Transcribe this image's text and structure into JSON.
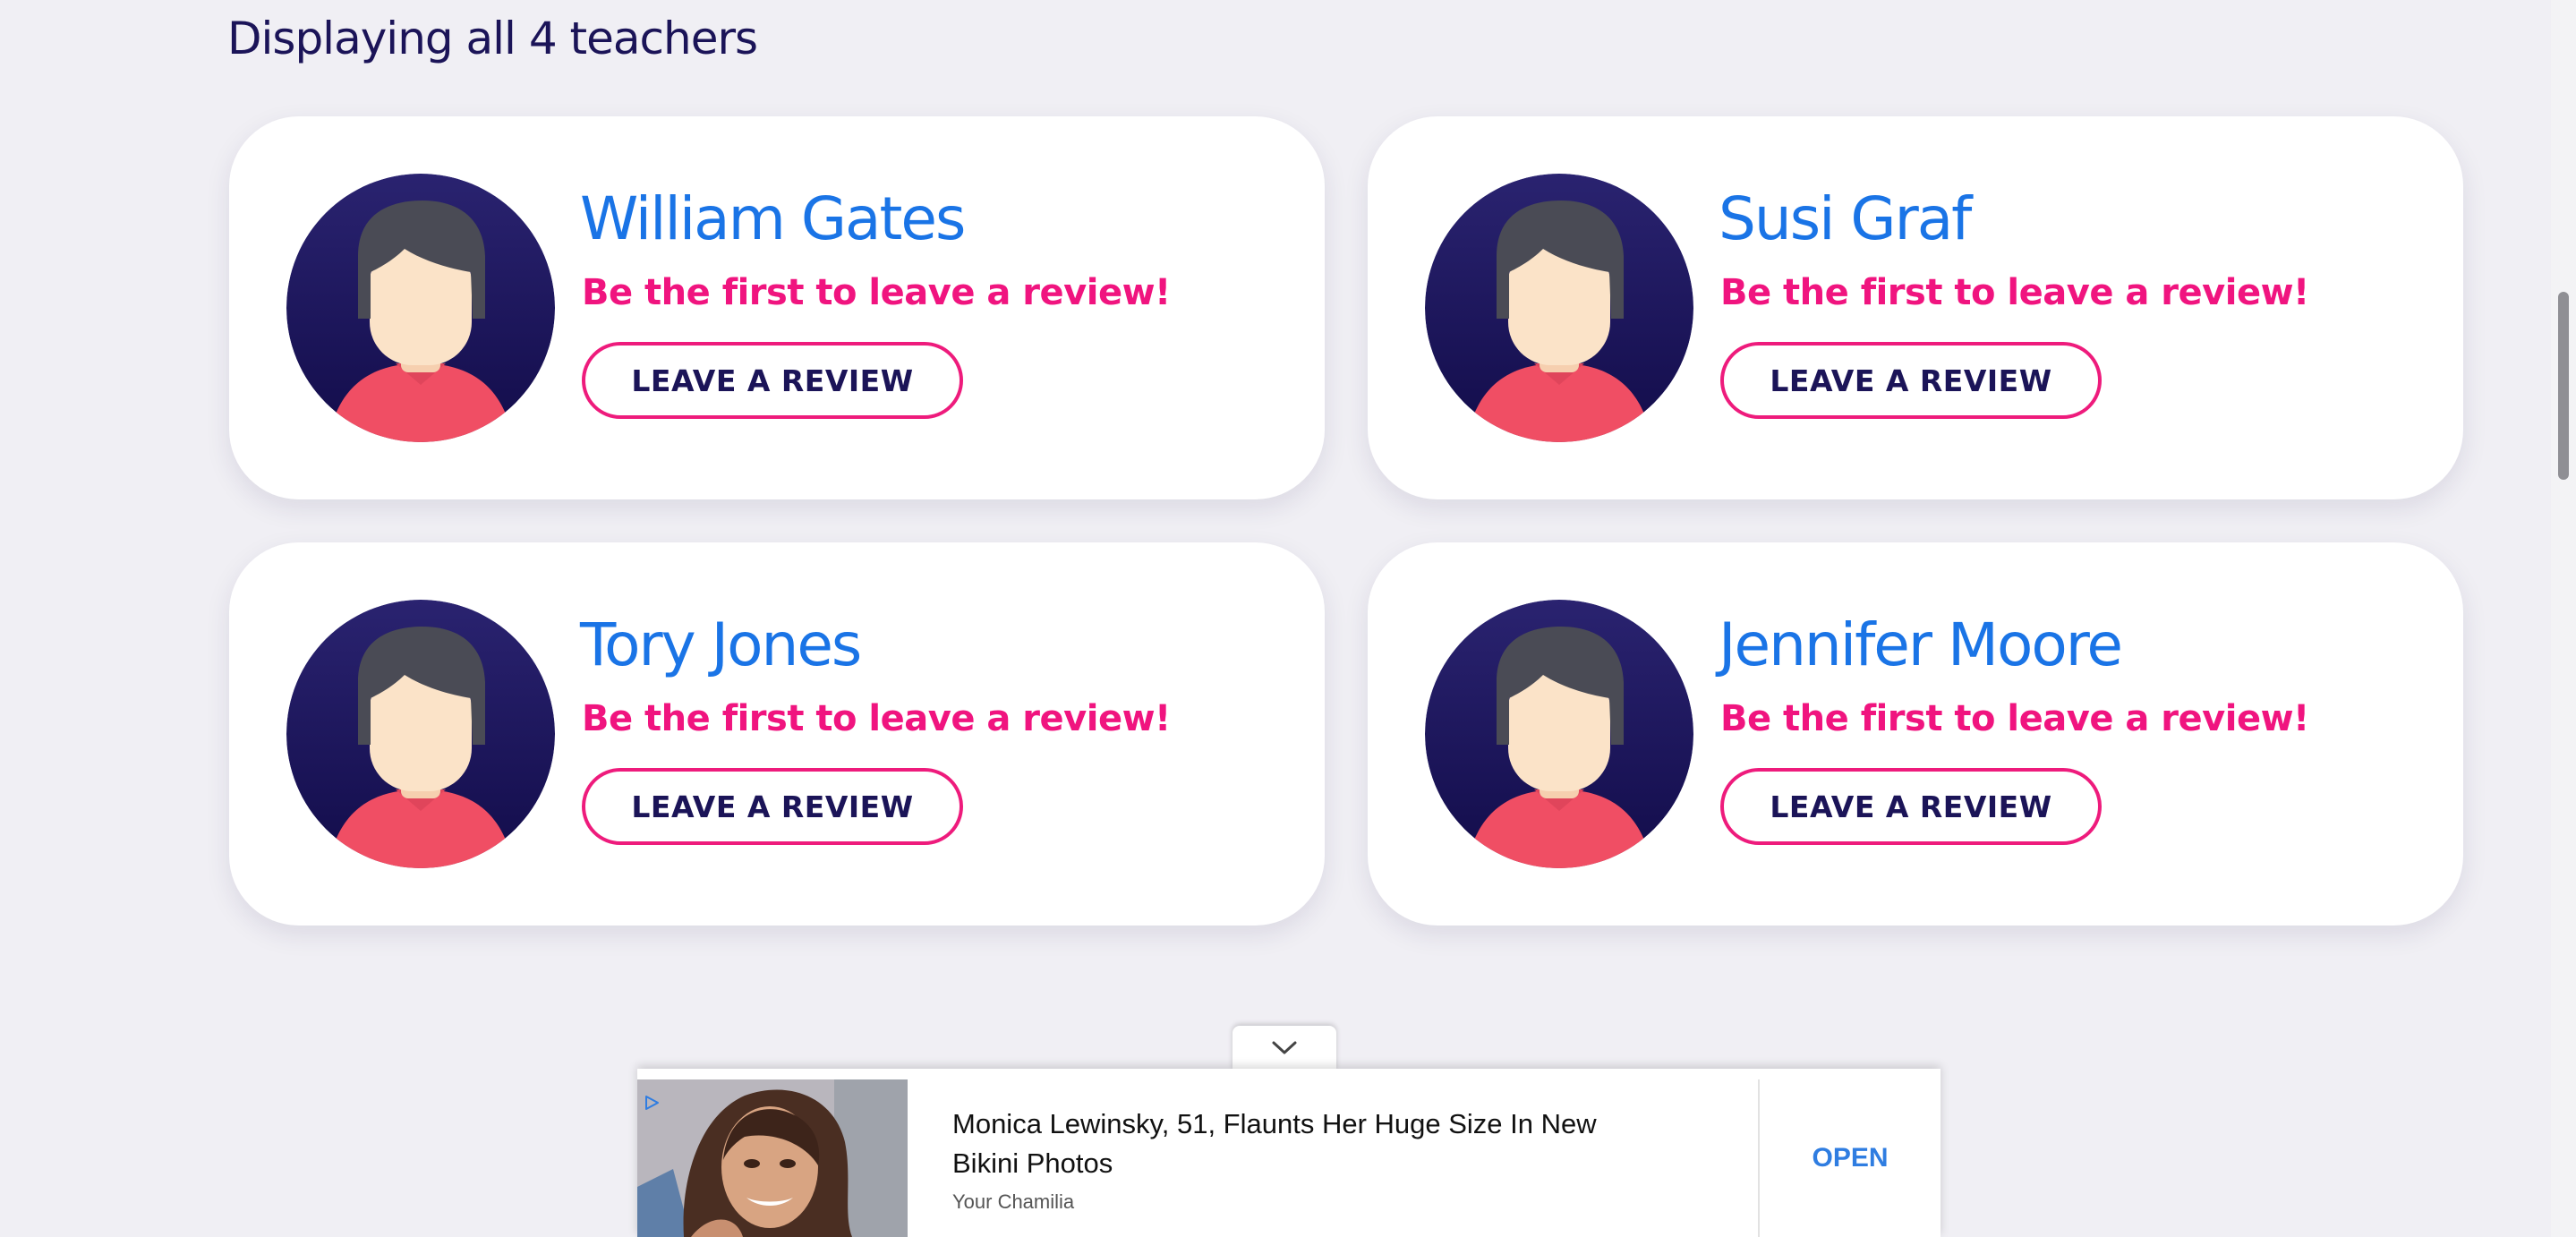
{
  "results": {
    "heading": "Displaying all 4 teachers"
  },
  "teachers": [
    {
      "name": "William Gates",
      "prompt": "Be the first to leave a review!",
      "button_label": "LEAVE A REVIEW"
    },
    {
      "name": "Susi Graf",
      "prompt": "Be the first to leave a review!",
      "button_label": "LEAVE A REVIEW"
    },
    {
      "name": "Tory Jones",
      "prompt": "Be the first to leave a review!",
      "button_label": "LEAVE A REVIEW"
    },
    {
      "name": "Jennifer Moore",
      "prompt": "Be the first to leave a review!",
      "button_label": "LEAVE A REVIEW"
    }
  ],
  "ad": {
    "headline": "Monica Lewinsky, 51, Flaunts Her Huge Size In New Bikini Photos",
    "source": "Your Chamilia",
    "cta": "OPEN",
    "toggle_icon": "chevron-down-icon",
    "choices_icon": "ad-choices-icon"
  },
  "colors": {
    "background": "#f0eff4",
    "heading": "#1b1458",
    "name": "#1a74e6",
    "prompt": "#f0147f",
    "button_border": "#ee1b7c",
    "button_text": "#1b1458",
    "avatar_circle": "#1b1458",
    "ad_cta": "#2f7de1"
  }
}
